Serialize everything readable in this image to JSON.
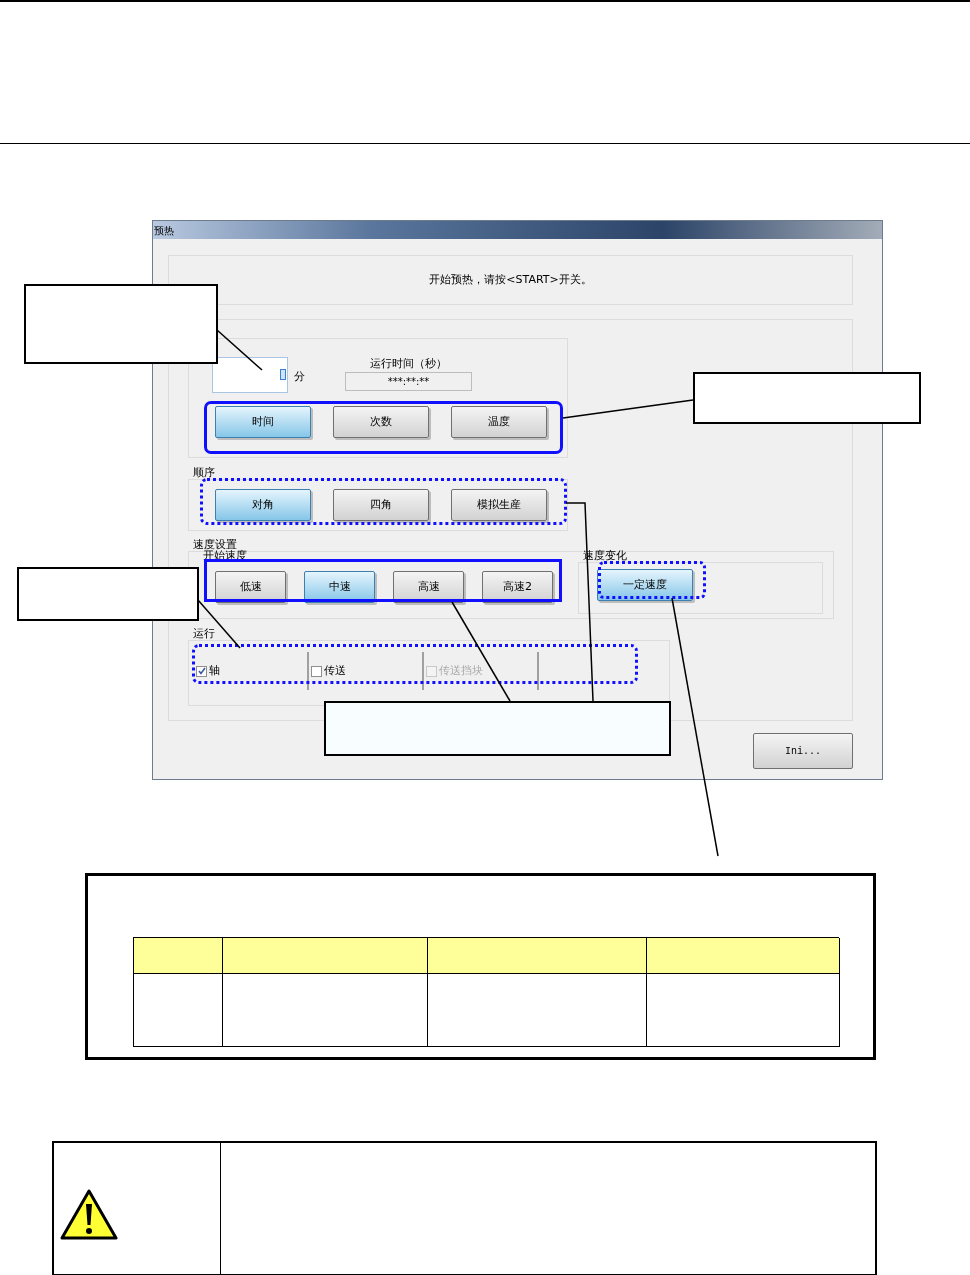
{
  "window": {
    "title": "预热"
  },
  "message": "开始预热，请按<START>开关。",
  "time_group": {
    "unit": "分",
    "runtime_label": "运行时间（秒）",
    "runtime_value": "***:**:**",
    "modes": [
      {
        "label": "时间",
        "selected": true
      },
      {
        "label": "次数",
        "selected": false
      },
      {
        "label": "温度",
        "selected": false
      }
    ]
  },
  "sequence": {
    "title": "顺序",
    "options": [
      {
        "label": "对角",
        "selected": true
      },
      {
        "label": "四角",
        "selected": false
      },
      {
        "label": "模拟生産",
        "selected": false
      }
    ]
  },
  "speed": {
    "title": "速度设置",
    "start_title": "开始速度",
    "options": [
      {
        "label": "低速",
        "selected": false
      },
      {
        "label": "中速",
        "selected": true
      },
      {
        "label": "高速",
        "selected": false
      },
      {
        "label": "高速2",
        "selected": false
      }
    ],
    "change_title": "速度变化",
    "change_options": [
      {
        "label": "一定速度",
        "selected": true
      }
    ]
  },
  "run": {
    "title": "运行",
    "items": [
      {
        "label": "轴",
        "checked": true,
        "disabled": false
      },
      {
        "label": "传送",
        "checked": false,
        "disabled": false
      },
      {
        "label": "传送挡块",
        "checked": false,
        "disabled": true
      }
    ]
  },
  "ini_button": "Ini..."
}
